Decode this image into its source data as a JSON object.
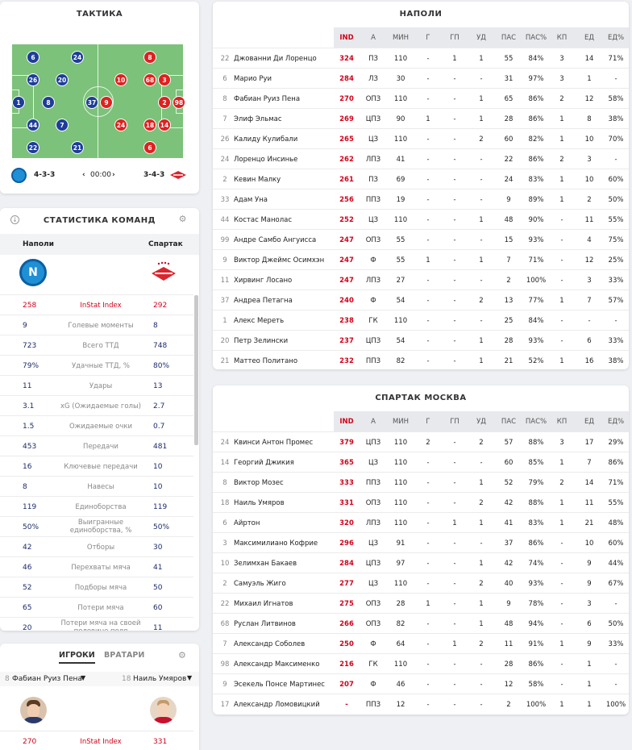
{
  "tactics": {
    "title": "ТАКТИКА",
    "home_formation": "4-3-3",
    "away_formation": "3-4-3",
    "time": "00:00",
    "home_players": [
      "6",
      "24",
      "26",
      "20",
      "1",
      "8",
      "37",
      "44",
      "7",
      "22",
      "21"
    ],
    "away_players": [
      "8",
      "10",
      "68",
      "3",
      "9",
      "2",
      "98",
      "24",
      "18",
      "14",
      "6"
    ],
    "colors": {
      "home": "#1d3d9a",
      "away": "#e02020",
      "pitch": "#7cc27a"
    }
  },
  "team_stats": {
    "title": "СТАТИСТИКА КОМАНД",
    "home_team": "Наполи",
    "away_team": "Спартак",
    "rows": [
      {
        "l": "258",
        "m": "InStat Index",
        "r": "292"
      },
      {
        "l": "9",
        "m": "Голевые моменты",
        "r": "8"
      },
      {
        "l": "723",
        "m": "Всего ТТД",
        "r": "748"
      },
      {
        "l": "79%",
        "m": "Удачные ТТД, %",
        "r": "80%"
      },
      {
        "l": "11",
        "m": "Удары",
        "r": "13"
      },
      {
        "l": "3.1",
        "m": "xG (Ожидаемые голы)",
        "r": "2.7"
      },
      {
        "l": "1.5",
        "m": "Ожидаемые очки",
        "r": "0.7"
      },
      {
        "l": "453",
        "m": "Передачи",
        "r": "481"
      },
      {
        "l": "16",
        "m": "Ключевые передачи",
        "r": "10"
      },
      {
        "l": "8",
        "m": "Навесы",
        "r": "10"
      },
      {
        "l": "119",
        "m": "Единоборства",
        "r": "119"
      },
      {
        "l": "50%",
        "m": "Выигранные единоборства, %",
        "r": "50%"
      },
      {
        "l": "42",
        "m": "Отборы",
        "r": "30"
      },
      {
        "l": "46",
        "m": "Перехваты мяча",
        "r": "41"
      },
      {
        "l": "52",
        "m": "Подборы мяча",
        "r": "50"
      },
      {
        "l": "65",
        "m": "Потери мяча",
        "r": "60"
      },
      {
        "l": "20",
        "m": "Потери мяча на своей половине поля",
        "r": "11"
      }
    ]
  },
  "players_panel": {
    "tab_players": "ИГРОКИ",
    "tab_keepers": "ВРАТАРИ",
    "home_num": "8",
    "home_player": "Фабиан Руиз Пена",
    "away_num": "18",
    "away_player": "Наиль Умяров",
    "home_index": "270",
    "index_label": "InStat Index",
    "away_index": "331"
  },
  "columns": [
    "IND",
    "А",
    "МИН",
    "Г",
    "ГП",
    "УД",
    "ПАС",
    "ПАС%",
    "КП",
    "ЕД",
    "ЕД%"
  ],
  "napoli": {
    "title": "НАПОЛИ",
    "rows": [
      [
        "22",
        "Джованни Ди Лоренцо",
        "324",
        "ПЗ",
        "110",
        "-",
        "1",
        "1",
        "55",
        "84%",
        "3",
        "14",
        "71%"
      ],
      [
        "6",
        "Марио Руи",
        "284",
        "ЛЗ",
        "30",
        "-",
        "-",
        "-",
        "31",
        "97%",
        "3",
        "1",
        "-"
      ],
      [
        "8",
        "Фабиан Руиз Пена",
        "270",
        "ОПЗ",
        "110",
        "-",
        "-",
        "1",
        "65",
        "86%",
        "2",
        "12",
        "58%"
      ],
      [
        "7",
        "Элиф Эльмас",
        "269",
        "ЦПЗ",
        "90",
        "1",
        "-",
        "1",
        "28",
        "86%",
        "1",
        "8",
        "38%"
      ],
      [
        "26",
        "Калиду Кулибали",
        "265",
        "ЦЗ",
        "110",
        "-",
        "-",
        "2",
        "60",
        "82%",
        "1",
        "10",
        "70%"
      ],
      [
        "24",
        "Лоренцо Инсинье",
        "262",
        "ЛПЗ",
        "41",
        "-",
        "-",
        "-",
        "22",
        "86%",
        "2",
        "3",
        "-"
      ],
      [
        "2",
        "Кевин Малку",
        "261",
        "ПЗ",
        "69",
        "-",
        "-",
        "-",
        "24",
        "83%",
        "1",
        "10",
        "60%"
      ],
      [
        "33",
        "Адам Уна",
        "256",
        "ППЗ",
        "19",
        "-",
        "-",
        "-",
        "9",
        "89%",
        "1",
        "2",
        "50%"
      ],
      [
        "44",
        "Костас Манолас",
        "252",
        "ЦЗ",
        "110",
        "-",
        "-",
        "1",
        "48",
        "90%",
        "-",
        "11",
        "55%"
      ],
      [
        "99",
        "Андре Самбо Ангуисса",
        "247",
        "ОПЗ",
        "55",
        "-",
        "-",
        "-",
        "15",
        "93%",
        "-",
        "4",
        "75%"
      ],
      [
        "9",
        "Виктор Джеймс Осимхэн",
        "247",
        "Ф",
        "55",
        "1",
        "-",
        "1",
        "7",
        "71%",
        "-",
        "12",
        "25%"
      ],
      [
        "11",
        "Хирвинг Лосано",
        "247",
        "ЛПЗ",
        "27",
        "-",
        "-",
        "-",
        "2",
        "100%",
        "-",
        "3",
        "33%"
      ],
      [
        "37",
        "Андреа Петагна",
        "240",
        "Ф",
        "54",
        "-",
        "-",
        "2",
        "13",
        "77%",
        "1",
        "7",
        "57%"
      ],
      [
        "1",
        "Алекс Мереть",
        "238",
        "ГК",
        "110",
        "-",
        "-",
        "-",
        "25",
        "84%",
        "-",
        "-",
        "-"
      ],
      [
        "20",
        "Петр Зелински",
        "237",
        "ЦПЗ",
        "54",
        "-",
        "-",
        "1",
        "28",
        "93%",
        "-",
        "6",
        "33%"
      ],
      [
        "21",
        "Маттео Политано",
        "232",
        "ППЗ",
        "82",
        "-",
        "-",
        "1",
        "21",
        "52%",
        "1",
        "16",
        "38%"
      ]
    ]
  },
  "spartak": {
    "title": "СПАРТАК МОСКВА",
    "rows": [
      [
        "24",
        "Квинси Антон Промес",
        "379",
        "ЦПЗ",
        "110",
        "2",
        "-",
        "2",
        "57",
        "88%",
        "3",
        "17",
        "29%"
      ],
      [
        "14",
        "Георгий Джикия",
        "365",
        "ЦЗ",
        "110",
        "-",
        "-",
        "-",
        "60",
        "85%",
        "1",
        "7",
        "86%"
      ],
      [
        "8",
        "Виктор Мозес",
        "333",
        "ППЗ",
        "110",
        "-",
        "-",
        "1",
        "52",
        "79%",
        "2",
        "14",
        "71%"
      ],
      [
        "18",
        "Наиль Умяров",
        "331",
        "ОПЗ",
        "110",
        "-",
        "-",
        "2",
        "42",
        "88%",
        "1",
        "11",
        "55%"
      ],
      [
        "6",
        "Айртон",
        "320",
        "ЛПЗ",
        "110",
        "-",
        "1",
        "1",
        "41",
        "83%",
        "1",
        "21",
        "48%"
      ],
      [
        "3",
        "Максимилиано Кофрие",
        "296",
        "ЦЗ",
        "91",
        "-",
        "-",
        "-",
        "37",
        "86%",
        "-",
        "10",
        "60%"
      ],
      [
        "10",
        "Зелимхан Бакаев",
        "284",
        "ЦПЗ",
        "97",
        "-",
        "-",
        "1",
        "42",
        "74%",
        "-",
        "9",
        "44%"
      ],
      [
        "2",
        "Самуэль Жиго",
        "277",
        "ЦЗ",
        "110",
        "-",
        "-",
        "2",
        "40",
        "93%",
        "-",
        "9",
        "67%"
      ],
      [
        "22",
        "Михаил Игнатов",
        "275",
        "ОПЗ",
        "28",
        "1",
        "-",
        "1",
        "9",
        "78%",
        "-",
        "3",
        "-"
      ],
      [
        "68",
        "Руслан Литвинов",
        "266",
        "ОПЗ",
        "82",
        "-",
        "-",
        "1",
        "48",
        "94%",
        "-",
        "6",
        "50%"
      ],
      [
        "7",
        "Александр Соболев",
        "250",
        "Ф",
        "64",
        "-",
        "1",
        "2",
        "11",
        "91%",
        "1",
        "9",
        "33%"
      ],
      [
        "98",
        "Александр Максименко",
        "216",
        "ГК",
        "110",
        "-",
        "-",
        "-",
        "28",
        "86%",
        "-",
        "1",
        "-"
      ],
      [
        "9",
        "Эсекель Понсе Мартинес",
        "207",
        "Ф",
        "46",
        "-",
        "-",
        "-",
        "12",
        "58%",
        "-",
        "1",
        "-"
      ],
      [
        "17",
        "Александр Ломовицкий",
        "-",
        "ППЗ",
        "12",
        "-",
        "-",
        "-",
        "2",
        "100%",
        "1",
        "1",
        "100%"
      ]
    ]
  }
}
